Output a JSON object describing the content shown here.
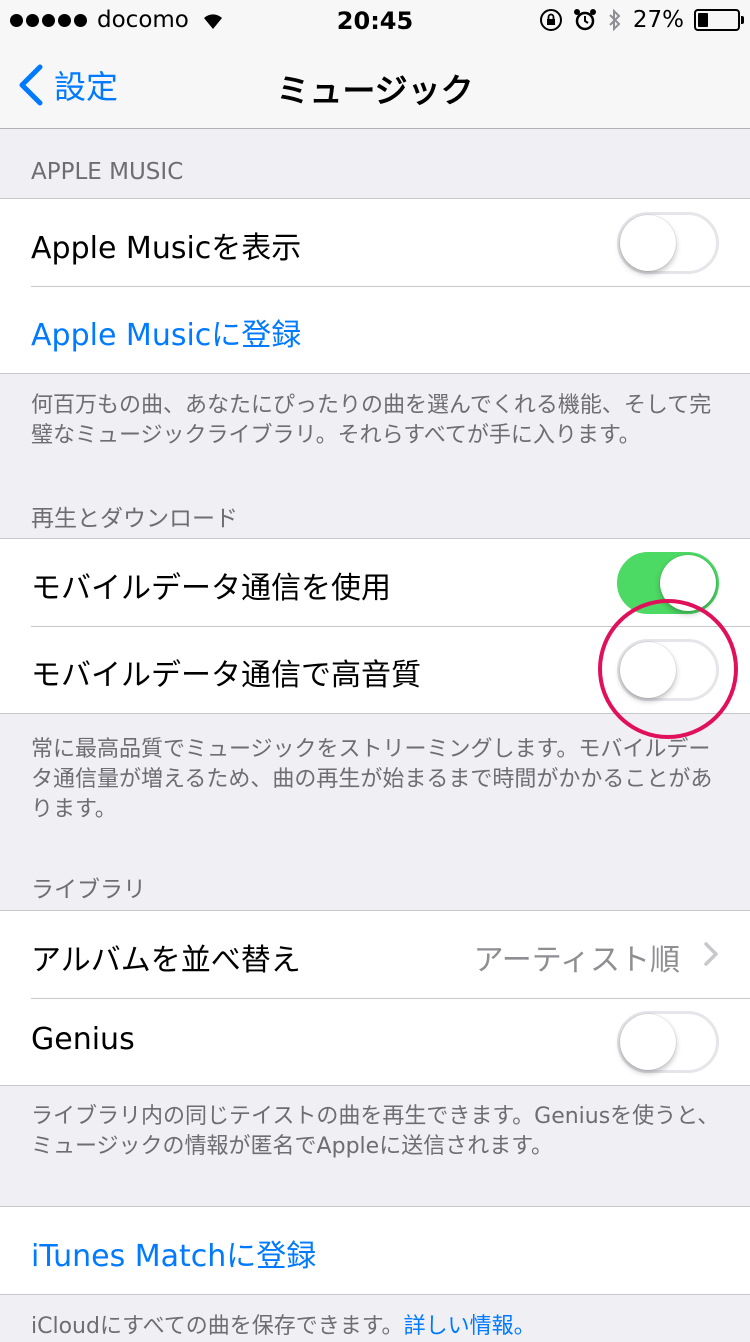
{
  "status_bar": {
    "carrier": "docomo",
    "time": "20:45",
    "battery": "27%",
    "battery_level": 0.27
  },
  "nav": {
    "back_label": "設定",
    "title": "ミュージック"
  },
  "sections": {
    "apple_music": {
      "header": "APPLE MUSIC",
      "show_label": "Apple Musicを表示",
      "show_on": false,
      "subscribe_label": "Apple Musicに登録",
      "footer": "何百万もの曲、あなたにぴったりの曲を選んでくれる機能、そして完璧なミュージックライブラリ。それらすべてが手に入ります。"
    },
    "playback": {
      "header": "再生とダウンロード",
      "cellular_label": "モバイルデータ通信を使用",
      "cellular_on": true,
      "hq_label": "モバイルデータ通信で高音質",
      "hq_on": false,
      "footer": "常に最高品質でミュージックをストリーミングします。モバイルデータ通信量が増えるため、曲の再生が始まるまで時間がかかることがあります。"
    },
    "library": {
      "header": "ライブラリ",
      "sort_label": "アルバムを並べ替え",
      "sort_value": "アーティスト順",
      "genius_label": "Genius",
      "genius_on": false,
      "footer": "ライブラリ内の同じテイストの曲を再生できます。Geniusを使うと、ミュージックの情報が匿名でAppleに送信されます。"
    },
    "itunes_match": {
      "label": "iTunes Matchに登録",
      "footer_text": "iCloudにすべての曲を保存できます。",
      "footer_link": "詳しい情報。"
    }
  },
  "colors": {
    "accent": "#007aff",
    "toggle_on": "#4cd964",
    "highlight": "#e0105a"
  }
}
